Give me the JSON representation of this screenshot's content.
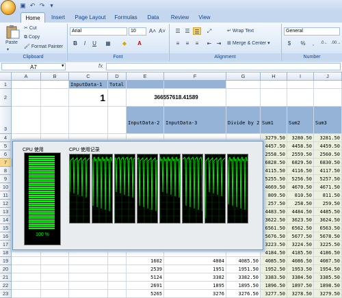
{
  "app": {
    "tabs": [
      "Home",
      "Insert",
      "Page Layout",
      "Formulas",
      "Data",
      "Review",
      "View"
    ],
    "active_tab": "Home"
  },
  "ribbon": {
    "clipboard": {
      "paste": "Paste",
      "cut": "Cut",
      "copy": "Copy",
      "format_painter": "Format Painter",
      "label": "Clipboard"
    },
    "font": {
      "name": "Arial",
      "size": "10",
      "label": "Font",
      "bold": "B",
      "italic": "I",
      "underline": "U"
    },
    "alignment": {
      "wrap": "Wrap Text",
      "merge": "Merge & Center",
      "label": "Alignment"
    },
    "number": {
      "format": "General",
      "label": "Number",
      "currency": "$",
      "percent": "%",
      "comma": ","
    }
  },
  "formula_bar": {
    "name_box": "A7",
    "fx": "fx",
    "formula": ""
  },
  "columns": [
    "A",
    "B",
    "C",
    "D",
    "E",
    "F",
    "G",
    "H",
    "I",
    "J"
  ],
  "rows": [
    "1",
    "2",
    "3",
    "4",
    "5",
    "6",
    "7",
    "8",
    "9",
    "10",
    "11",
    "12",
    "13",
    "14",
    "15",
    "16",
    "17",
    "18",
    "19",
    "20",
    "21",
    "22",
    "23"
  ],
  "cells": {
    "c1": "InputData-1",
    "d1": "Total",
    "c2": "1",
    "ef2": "366557618.41589",
    "e3": "InputData-2",
    "f3": "InputData-3",
    "g3": "Divide by 2",
    "h3": "Sum1",
    "i3": "Sum2",
    "j3": "Sum3"
  },
  "data_rows": [
    {
      "r": "4",
      "h": "3279.50",
      "i": "3280.50",
      "j": "3281.50"
    },
    {
      "r": "5",
      "h": "4457.50",
      "i": "4458.50",
      "j": "4459.50"
    },
    {
      "r": "6",
      "h": "2558.50",
      "i": "2559.50",
      "j": "2560.50"
    },
    {
      "r": "7",
      "h": "6828.50",
      "i": "6829.50",
      "j": "6830.50"
    },
    {
      "r": "8",
      "h": "4115.50",
      "i": "4116.50",
      "j": "4117.50"
    },
    {
      "r": "9",
      "h": "5255.50",
      "i": "5256.50",
      "j": "5257.50"
    },
    {
      "r": "10",
      "h": "4669.50",
      "i": "4670.50",
      "j": "4671.50"
    },
    {
      "r": "11",
      "h": "809.50",
      "i": "810.50",
      "j": "811.50"
    },
    {
      "r": "12",
      "h": "257.50",
      "i": "258.50",
      "j": "259.50"
    },
    {
      "r": "13",
      "h": "4483.50",
      "i": "4484.50",
      "j": "4485.50"
    },
    {
      "r": "14",
      "h": "3622.50",
      "i": "3623.50",
      "j": "3624.50"
    },
    {
      "r": "15",
      "h": "6561.50",
      "i": "6562.50",
      "j": "6563.50"
    },
    {
      "r": "16",
      "h": "5676.50",
      "i": "5677.50",
      "j": "5678.50"
    },
    {
      "r": "17",
      "h": "3223.50",
      "i": "3224.50",
      "j": "3225.50"
    },
    {
      "r": "18",
      "h": "4184.50",
      "i": "4185.50",
      "j": "4186.50"
    },
    {
      "r": "19",
      "e": "1602",
      "f": "4084",
      "g": "4085.50",
      "h": "4085.50",
      "i": "4086.50",
      "j": "4087.50"
    },
    {
      "r": "20",
      "e": "2539",
      "f": "1951",
      "g": "1951.50",
      "h": "1952.50",
      "i": "1953.50",
      "j": "1954.50"
    },
    {
      "r": "21",
      "e": "5124",
      "f": "3382",
      "g": "3382.50",
      "h": "3383.50",
      "i": "3384.50",
      "j": "3385.50"
    },
    {
      "r": "22",
      "e": "2691",
      "f": "1895",
      "g": "1895.50",
      "h": "1896.50",
      "i": "1897.50",
      "j": "1898.50"
    },
    {
      "r": "23",
      "e": "5265",
      "f": "3276",
      "g": "3276.50",
      "h": "3277.50",
      "i": "3278.50",
      "j": "3279.50"
    }
  ],
  "task_manager": {
    "cpu_usage_label": "CPU 使用",
    "cpu_history_label": "CPU 使用记录",
    "cpu_percent": "100 %",
    "cpu_level": 1.0,
    "graph_count": 8
  },
  "colors": {
    "header_blue": "#95b3d7",
    "row_green": "#ebf1de",
    "graph_green": "#00ff00"
  }
}
